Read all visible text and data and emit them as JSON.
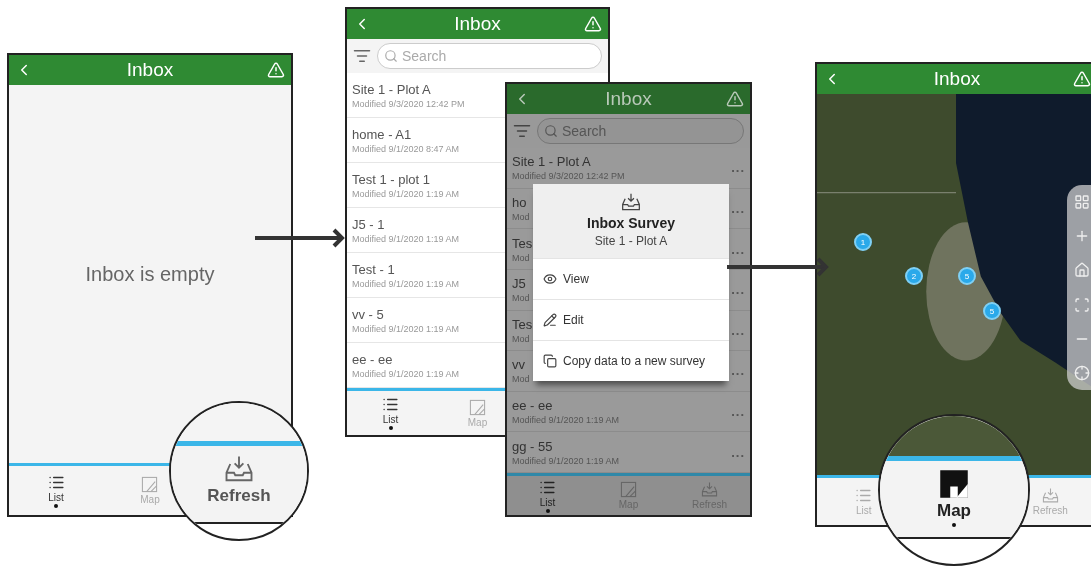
{
  "screens": [
    {
      "kind": "empty",
      "dimmed": false,
      "title": "Inbox",
      "message": "Inbox is empty",
      "tabs": [
        {
          "kind": "list",
          "label": "List",
          "selected": true,
          "magnified": false
        },
        {
          "kind": "map",
          "label": "Map",
          "selected": false,
          "magnified": false
        },
        {
          "kind": "refresh",
          "label": "Refresh",
          "selected": false,
          "magnified": true
        }
      ]
    },
    {
      "kind": "list",
      "dimmed": false,
      "title": "Inbox",
      "search": {
        "placeholder": "Search"
      },
      "rows": [
        {
          "title": "Site 1 - Plot A",
          "modified": "Modified 9/3/2020 12:42 PM"
        },
        {
          "title": "home - A1",
          "modified": "Modified 9/1/2020 8:47 AM"
        },
        {
          "title": "Test 1 - plot 1",
          "modified": "Modified 9/1/2020 1:19 AM"
        },
        {
          "title": "J5 - 1",
          "modified": "Modified 9/1/2020 1:19 AM"
        },
        {
          "title": "Test - 1",
          "modified": "Modified 9/1/2020 1:19 AM"
        },
        {
          "title": "vv - 5",
          "modified": "Modified 9/1/2020 1:19 AM"
        },
        {
          "title": "ee - ee",
          "modified": "Modified 9/1/2020 1:19 AM"
        }
      ],
      "tabs": [
        {
          "kind": "list",
          "label": "List",
          "selected": true,
          "magnified": false
        },
        {
          "kind": "map",
          "label": "Map",
          "selected": false,
          "magnified": false
        }
      ]
    },
    {
      "kind": "list",
      "dimmed": true,
      "title": "Inbox",
      "search": {
        "placeholder": "Search"
      },
      "rows": [
        {
          "title": "Site 1 - Plot A",
          "modified": "Modified 9/3/2020 12:42 PM",
          "menu_button": "..."
        },
        {
          "title": "ho",
          "modified": "Mod",
          "menu_button": "..."
        },
        {
          "title": "Tes",
          "modified": "Mod",
          "menu_button": "..."
        },
        {
          "title": "J5",
          "modified": "Mod",
          "menu_button": "..."
        },
        {
          "title": "Tes",
          "modified": "Mod",
          "menu_button": "..."
        },
        {
          "title": "vv",
          "modified": "Mod",
          "menu_button": "..."
        },
        {
          "title": "ee - ee",
          "modified": "Modified 9/1/2020 1:19 AM",
          "menu_button": "..."
        },
        {
          "title": "gg - 55",
          "modified": "Modified 9/1/2020 1:19 AM",
          "menu_button": "..."
        }
      ],
      "menu": {
        "title": "Inbox Survey",
        "subtitle": "Site 1 - Plot A",
        "items": [
          {
            "kind": "view",
            "label": "View"
          },
          {
            "kind": "edit",
            "label": "Edit"
          },
          {
            "kind": "copy",
            "label": "Copy data to a new survey"
          }
        ]
      },
      "tabs": [
        {
          "kind": "list",
          "label": "List",
          "selected": true,
          "magnified": false
        },
        {
          "kind": "map",
          "label": "Map",
          "selected": false,
          "magnified": false
        },
        {
          "kind": "refresh",
          "label": "Refresh",
          "selected": false,
          "magnified": false
        }
      ]
    },
    {
      "kind": "map",
      "dimmed": false,
      "title": "Inbox",
      "markers": [
        {
          "count": "1"
        },
        {
          "count": "2"
        },
        {
          "count": "5"
        },
        {
          "count": "5"
        }
      ],
      "tabs": [
        {
          "kind": "list",
          "label": "List",
          "selected": false,
          "magnified": false
        },
        {
          "kind": "map",
          "label": "Map",
          "selected": true,
          "magnified": true
        },
        {
          "kind": "refresh",
          "label": "Refresh",
          "selected": false,
          "magnified": false
        }
      ]
    }
  ]
}
